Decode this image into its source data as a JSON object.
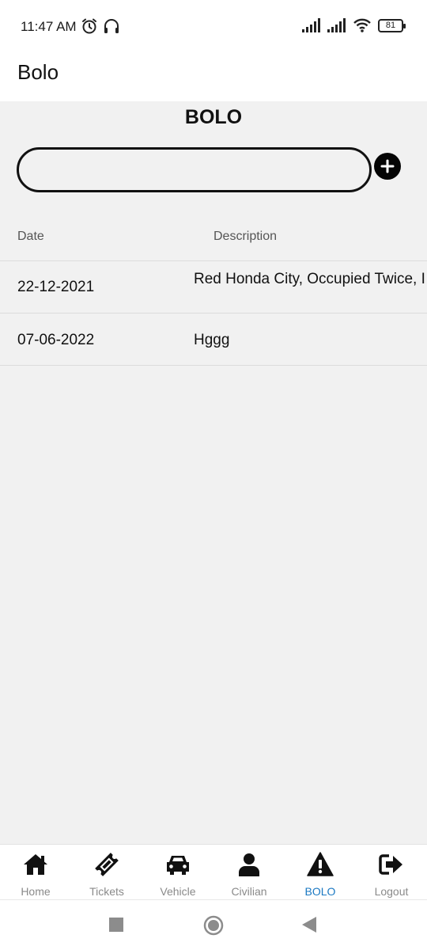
{
  "status_bar": {
    "time": "11:47 AM",
    "left_icons": [
      "alarm-icon",
      "headphones-icon"
    ],
    "right_icons": [
      "signal-icon",
      "signal-icon",
      "wifi-icon"
    ],
    "battery": "81"
  },
  "app_bar": {
    "title": "Bolo"
  },
  "page": {
    "heading": "BOLO",
    "search": {
      "value": "",
      "placeholder": ""
    },
    "add_icon": "plus-circle-icon"
  },
  "table": {
    "columns": [
      "Date",
      "Description"
    ],
    "rows": [
      {
        "date": "22-12-2021",
        "description": "Red Honda City, Occupied Twice, I"
      },
      {
        "date": "07-06-2022",
        "description": "Hggg"
      }
    ]
  },
  "bottom_nav": {
    "active": "BOLO",
    "active_color": "#1a78c2",
    "items": [
      {
        "label": "Home",
        "icon": "home-icon"
      },
      {
        "label": "Tickets",
        "icon": "ticket-icon"
      },
      {
        "label": "Vehicle",
        "icon": "car-icon"
      },
      {
        "label": "Civilian",
        "icon": "person-icon"
      },
      {
        "label": "BOLO",
        "icon": "warning-icon"
      },
      {
        "label": "Logout",
        "icon": "logout-icon"
      }
    ]
  },
  "system_nav": [
    "recents-icon",
    "home-circle-icon",
    "back-icon"
  ]
}
